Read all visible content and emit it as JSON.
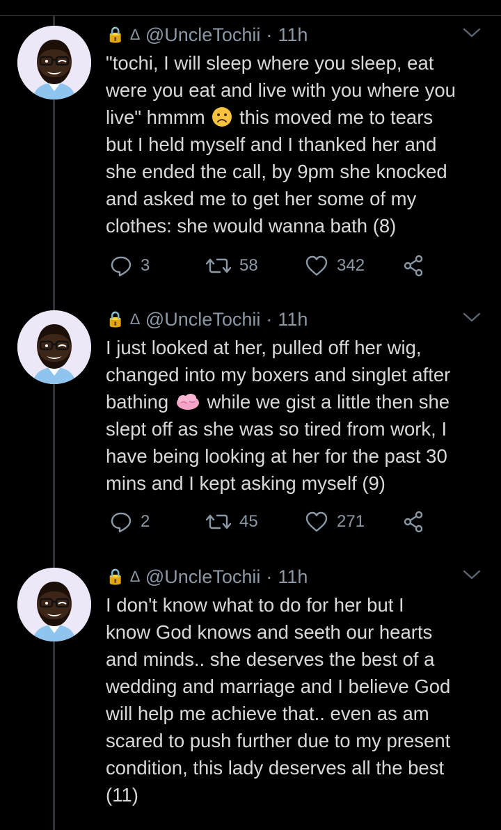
{
  "tweets": [
    {
      "lock_icon": "🔒",
      "verified_icon": "∆",
      "handle": "@UncleTochii",
      "separator": "·",
      "time": "11h",
      "lines": [
        "\"tochi, I will sleep where you sleep, eat",
        "were you eat and live with you where you",
        "live\"  hmmm",
        " this moved me to tears",
        "but I held myself and I thanked her and",
        "she ended the call, by 9pm she knocked",
        "and asked me to get her some of my",
        "clothes: she would wanna bath  (8)"
      ],
      "replies": "3",
      "retweets": "58",
      "likes": "342"
    },
    {
      "lock_icon": "🔒",
      "verified_icon": "∆",
      "handle": "@UncleTochii",
      "separator": "·",
      "time": "11h",
      "lines": [
        "I just looked at her, pulled off her wig,",
        "changed into my boxers and singlet after",
        "bathing",
        " while we gist a little then she",
        "slept off as she was so tired from work, I",
        "have being looking at her for the past 30",
        "mins and I kept asking myself (9)"
      ],
      "replies": "2",
      "retweets": "45",
      "likes": "271"
    },
    {
      "lock_icon": "🔒",
      "verified_icon": "∆",
      "handle": "@UncleTochii",
      "separator": "·",
      "time": "11h",
      "lines": [
        "I don't know what to do for her but I",
        "know God knows and seeth our hearts",
        "and minds.. she deserves the best of a",
        "wedding and marriage and I believe God",
        "will help me achieve that.. even as am",
        "scared to push further due to my present",
        "condition, this lady deserves all the best",
        "(11)"
      ]
    }
  ],
  "icons": {
    "reply": "reply-icon",
    "retweet": "retweet-icon",
    "like": "heart-icon",
    "share": "share-icon",
    "more": "chevron-down-icon",
    "emoji_1": "worried-face-emoji",
    "emoji_2": "pink-cloud-brain-emoji"
  },
  "colors": {
    "background": "#000000",
    "text": "#d9d9d9",
    "secondary": "#8b98a5",
    "thread_line": "#2f3336",
    "avatar_bg": "#ece8f8"
  }
}
